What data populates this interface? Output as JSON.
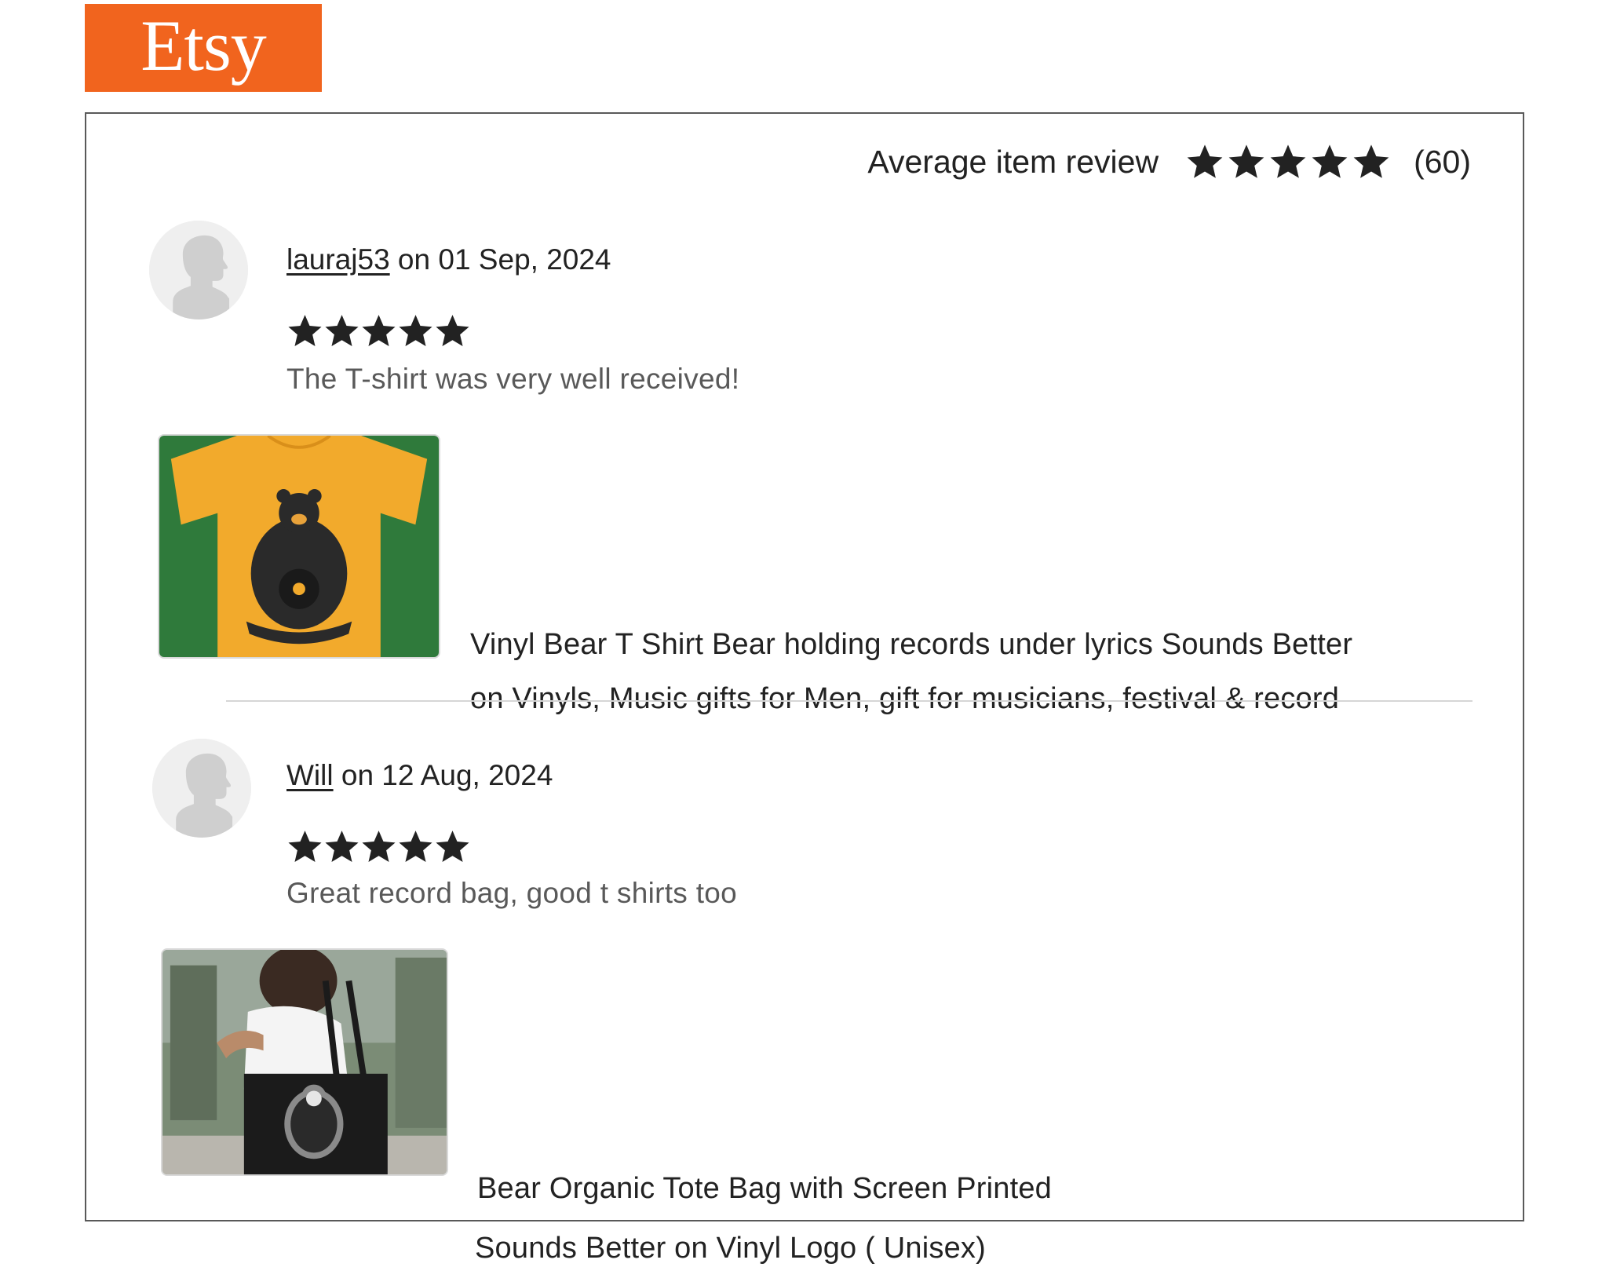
{
  "logo": {
    "text": "Etsy"
  },
  "summary": {
    "label": "Average item review",
    "rating": 5,
    "count": "(60)"
  },
  "reviews": [
    {
      "username": "lauraj53",
      "date_text": " on 01 Sep, 2024",
      "rating": 5,
      "text": "The T-shirt was very well received!",
      "product_line1": "Vinyl Bear T Shirt Bear holding records under lyrics Sounds Better",
      "product_line2": "on Vinyls, Music gifts for Men,  gift for musicians, festival & record"
    },
    {
      "username": "Will",
      "date_text": " on 12 Aug, 2024",
      "rating": 5,
      "text": "Great record bag, good t shirts too",
      "product_line1": "Bear Organic Tote Bag with Screen Printed",
      "product_line2": "Sounds Better on Vinyl Logo ( Unisex)"
    }
  ],
  "colors": {
    "brand": "#f1641e",
    "star": "#222222",
    "shirt": "#f2aa2c",
    "shirt_bg": "#2f7a3b"
  }
}
